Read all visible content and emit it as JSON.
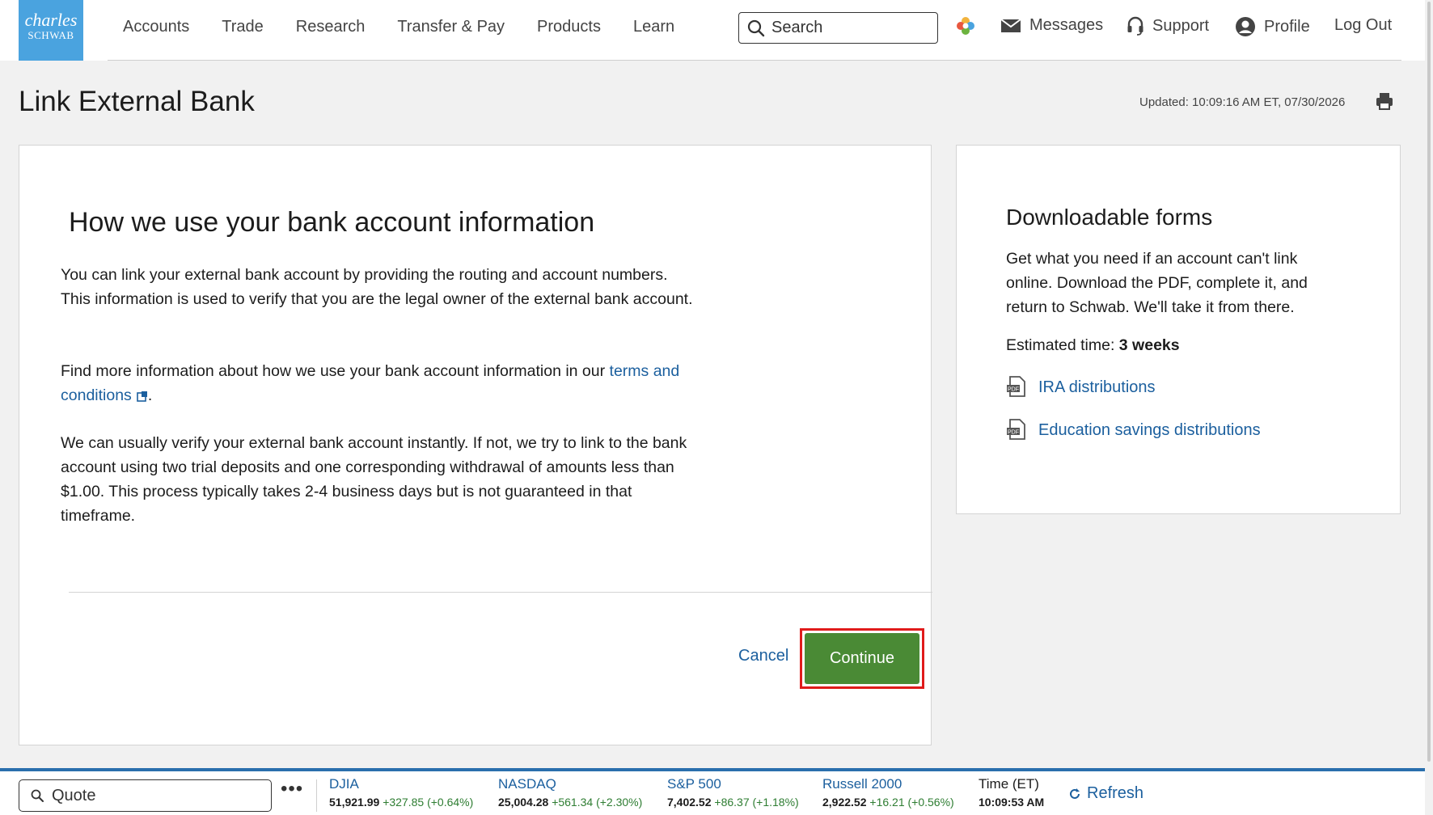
{
  "header": {
    "logo_line1": "charles",
    "logo_line2": "SCHWAB",
    "nav": [
      "Accounts",
      "Trade",
      "Research",
      "Transfer & Pay",
      "Products",
      "Learn"
    ],
    "search_placeholder": "Search",
    "messages": "Messages",
    "support": "Support",
    "profile": "Profile",
    "logout": "Log Out"
  },
  "page": {
    "title": "Link External Bank",
    "updated": "Updated: 10:09:16 AM ET, 07/30/2026"
  },
  "main_card": {
    "title": "How we use your bank account information",
    "p1": "You can link your external bank account by providing the routing and account numbers. This information is used to verify that you are the legal owner of the external bank account.",
    "p2_before": "Find more information about how we use your bank account information in our ",
    "p2_link": "terms and conditions",
    "p2_after": ".",
    "p3": "We can usually verify your external bank account instantly. If not, we try to link to the bank account using two trial deposits and one corresponding withdrawal of amounts less than $1.00. This process typically takes 2-4 business days but is not guaranteed in that timeframe.",
    "cancel": "Cancel",
    "continue": "Continue"
  },
  "side_card": {
    "title": "Downloadable forms",
    "text": "Get what you need if an account can't link online. Download the PDF, complete it, and return to Schwab. We'll take it from there.",
    "est_label": "Estimated time: ",
    "est_value": "3 weeks",
    "forms": [
      "IRA distributions",
      "Education savings distributions"
    ]
  },
  "ticker": {
    "quote_placeholder": "Quote",
    "more": "•••",
    "indices": [
      {
        "name": "DJIA",
        "value": "51,921.99",
        "change": "+327.85 (+0.64%)"
      },
      {
        "name": "NASDAQ",
        "value": "25,004.28",
        "change": "+561.34 (+2.30%)"
      },
      {
        "name": "S&P 500",
        "value": "7,402.52",
        "change": "+86.37 (+1.18%)"
      },
      {
        "name": "Russell 2000",
        "value": "2,922.52",
        "change": "+16.21 (+0.56%)"
      }
    ],
    "time_label": "Time (ET)",
    "time_value": "10:09:53 AM",
    "refresh": "Refresh"
  },
  "colors": {
    "brand": "#4aa3df",
    "link": "#1b5f9e",
    "continue": "#4a8a35",
    "highlight": "#e01b1b",
    "positive": "#2e7d32"
  },
  "icons": [
    "search-icon",
    "app-switcher-icon",
    "mail-icon",
    "headset-icon",
    "user-circle-icon",
    "print-icon",
    "external-link-icon",
    "pdf-icon",
    "refresh-icon"
  ]
}
